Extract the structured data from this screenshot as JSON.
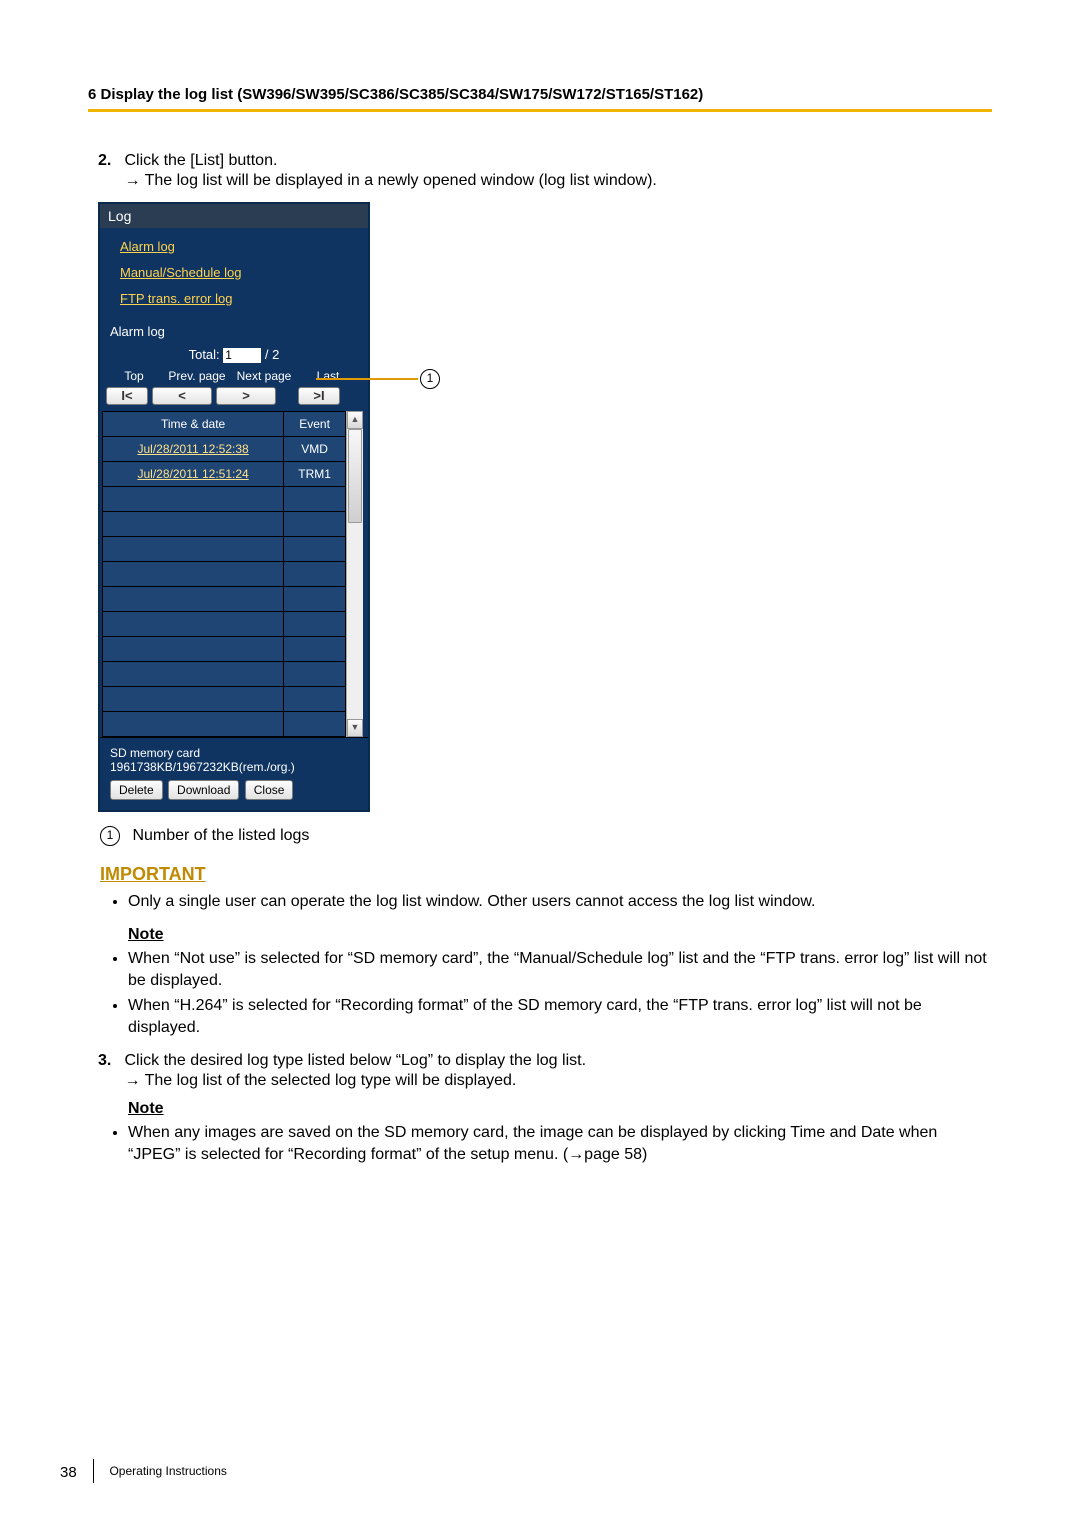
{
  "chapter_title": "6 Display the log list (SW396/SW395/SC386/SC385/SC384/SW175/SW172/ST165/ST162)",
  "step2": {
    "num": "2.",
    "text": "Click the [List] button.",
    "sub": "→ The log list will be displayed in a newly opened window (log list window)."
  },
  "logwin": {
    "title": "Log",
    "links": [
      "Alarm log",
      "Manual/Schedule log",
      "FTP trans. error log"
    ],
    "section": "Alarm log",
    "total_label": "Total:",
    "total_value": "1",
    "total_suffix": "/ 2",
    "nav_labels": {
      "top": "Top",
      "prev": "Prev. page",
      "next": "Next page",
      "last": "Last"
    },
    "nav_btn_glyphs": {
      "top": "I<",
      "prev": "<",
      "next": ">",
      "last": ">I"
    },
    "th_time": "Time & date",
    "th_event": "Event",
    "rows": [
      {
        "time": "Jul/28/2011 12:52:38",
        "event": "VMD"
      },
      {
        "time": "Jul/28/2011 12:51:24",
        "event": "TRM1"
      }
    ],
    "empty_rows": 10,
    "sd_title": "SD memory card",
    "sd_info": "1961738KB/1967232KB(rem./org.)",
    "btn_delete": "Delete",
    "btn_download": "Download",
    "btn_close": "Close"
  },
  "callout1": {
    "num": "1",
    "caption": "Number of the listed logs"
  },
  "important_label": "IMPORTANT",
  "important_items": [
    "Only a single user can operate the log list window. Other users cannot access the log list window."
  ],
  "note_label": "Note",
  "note1_items": [
    "When “Not use” is selected for “SD memory card”, the “Manual/Schedule log” list and the “FTP trans. error log” list will not be displayed.",
    "When “H.264” is selected for “Recording format” of the SD memory card, the “FTP trans. error log” list will not be displayed."
  ],
  "step3": {
    "num": "3.",
    "text": "Click the desired log type listed below “Log” to display the log list.",
    "sub": "→ The log list of the selected log type will be displayed."
  },
  "note2_items": [
    "When any images are saved on the SD memory card, the image can be displayed by clicking Time and Date when “JPEG” is selected for “Recording format” of the setup menu. (→page 58)"
  ],
  "footer": {
    "page": "38",
    "label": "Operating Instructions"
  }
}
